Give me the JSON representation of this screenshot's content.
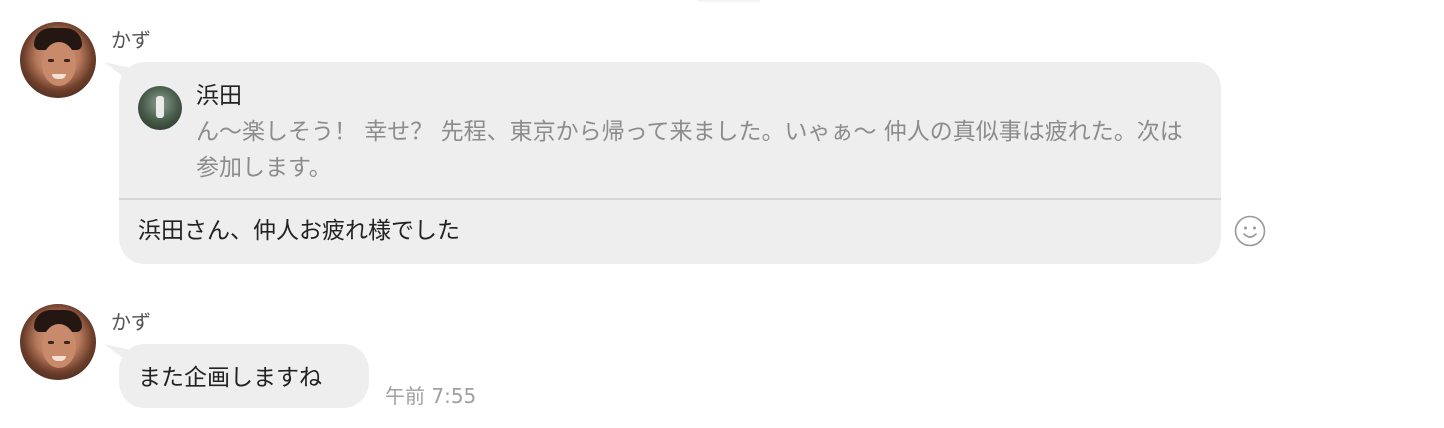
{
  "messages": [
    {
      "sender": "かず",
      "quote": {
        "sender": "浜田",
        "text": "ん〜楽しそう！ 幸せ？ 先程、東京から帰って来ました。いゃぁ〜 仲人の真似事は疲れた。次は参加します。"
      },
      "text": "浜田さん、仲人お疲れ様でした",
      "reaction_icon": "smile-icon"
    },
    {
      "sender": "かず",
      "text": "また企画しますね",
      "time": "午前 7:55"
    }
  ]
}
